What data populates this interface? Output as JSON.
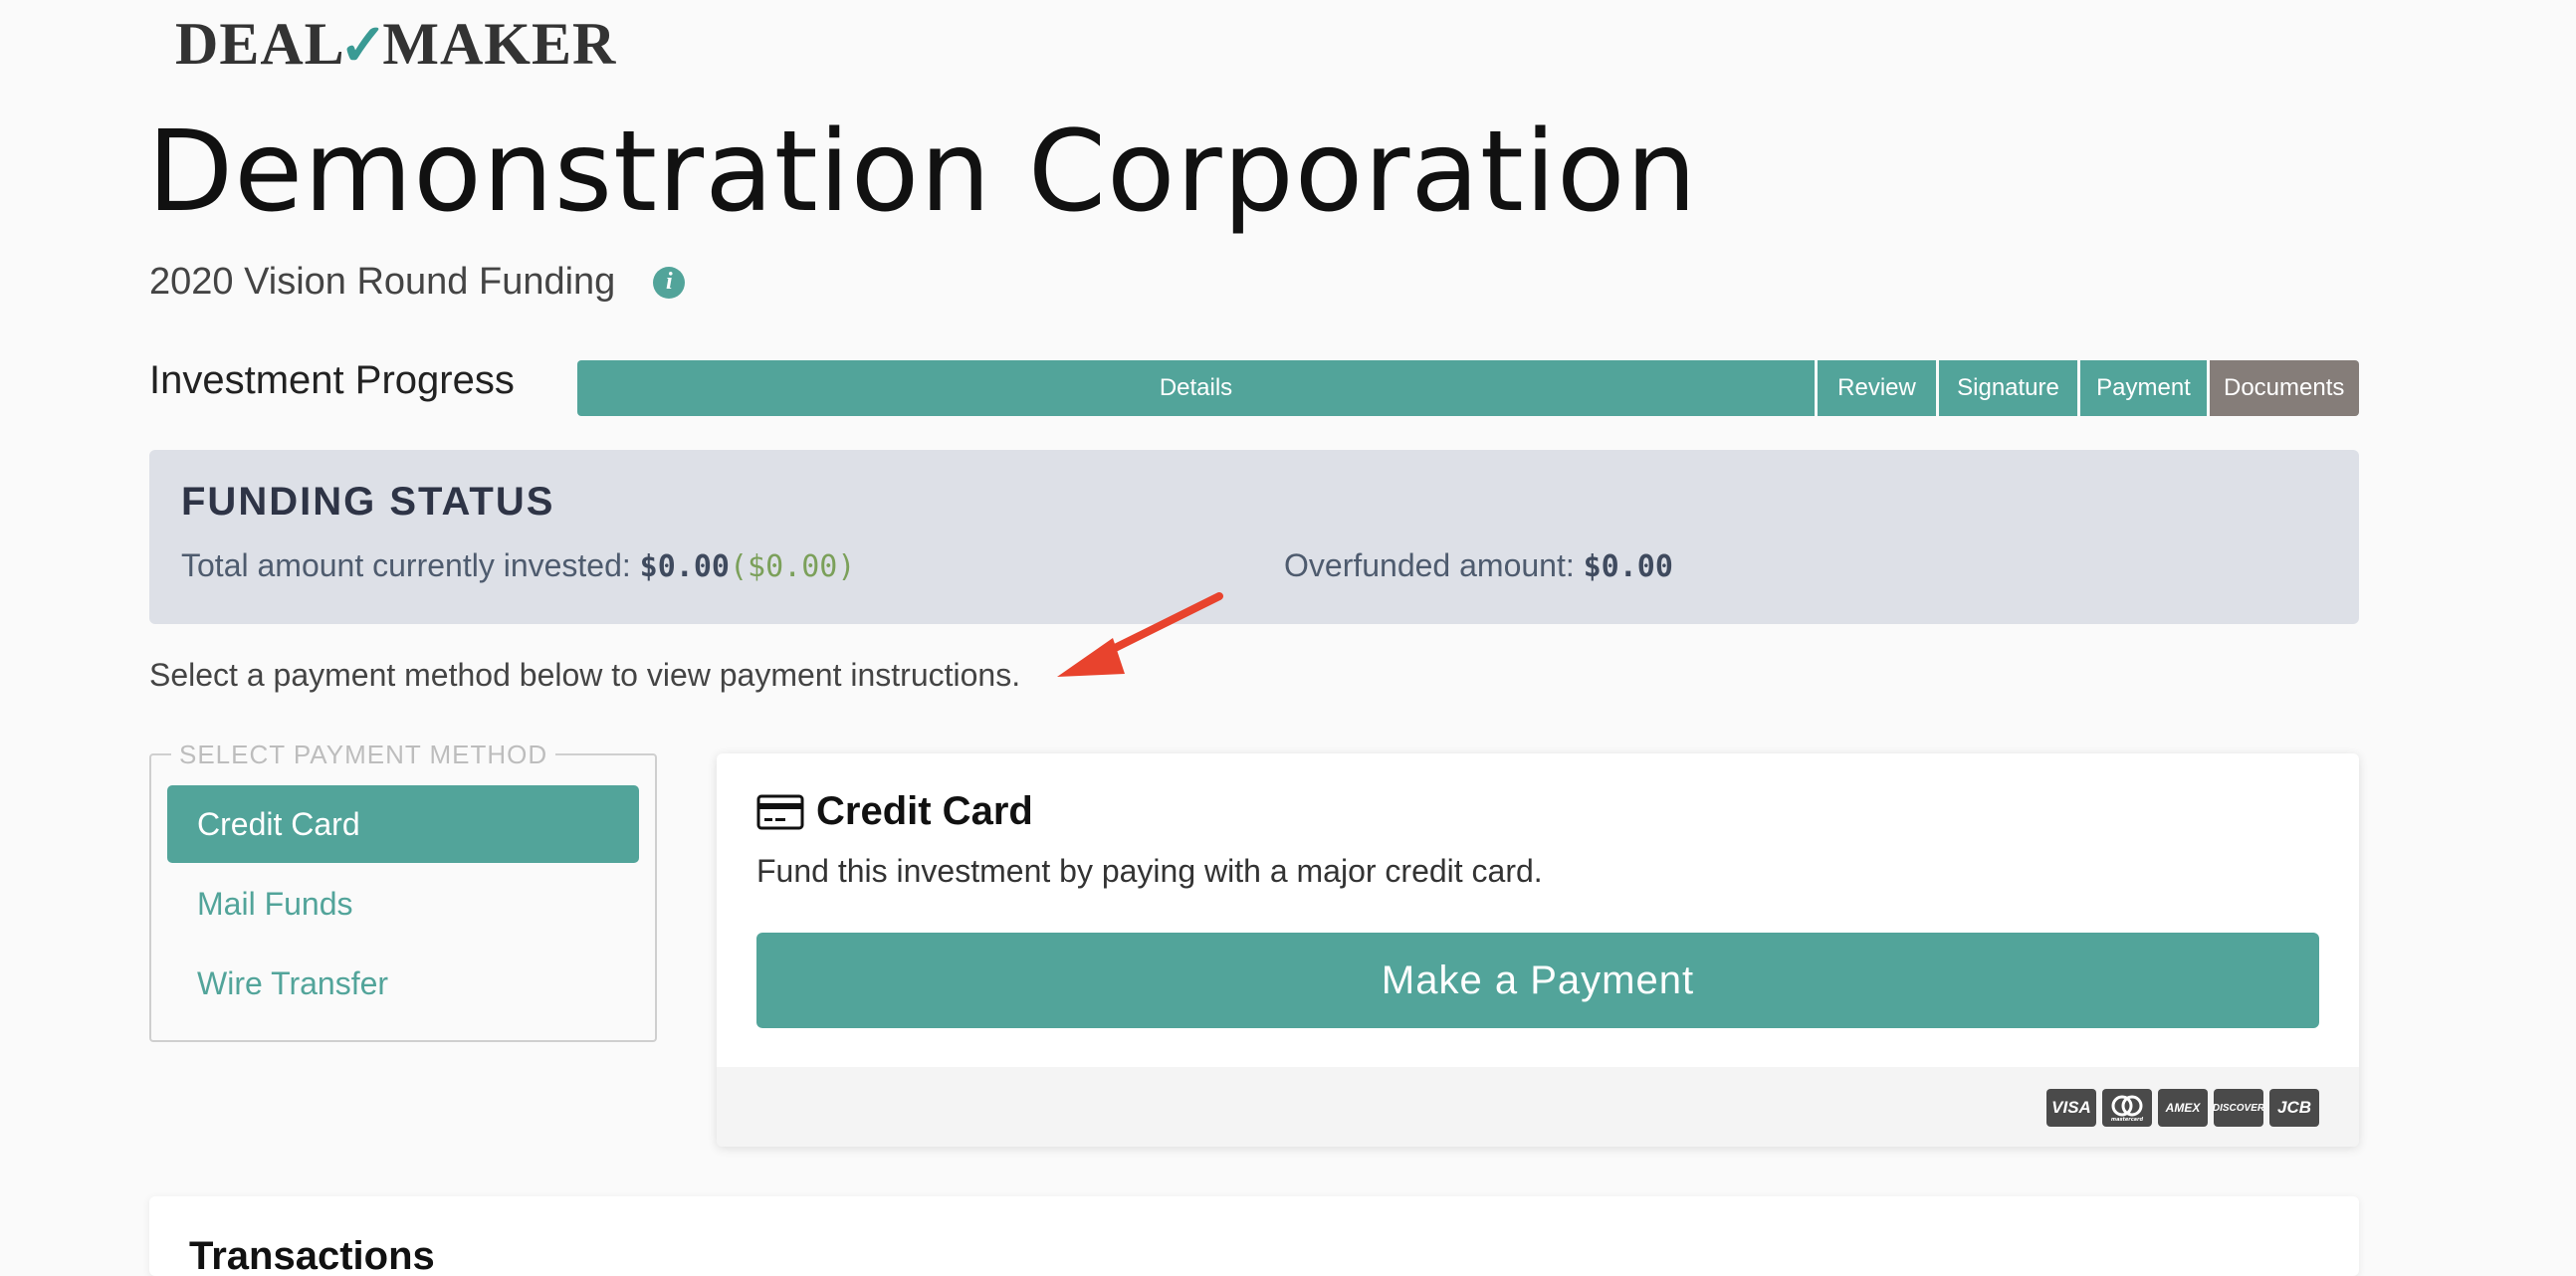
{
  "logo": {
    "left": "DEAL",
    "mark": "✓",
    "right": "MAKER"
  },
  "company_name": "Demonstration Corporation",
  "round_name": "2020 Vision Round Funding",
  "investment_progress": {
    "label": "Investment Progress",
    "steps": [
      "Details",
      "Review",
      "Signature",
      "Payment",
      "Documents"
    ]
  },
  "funding_status": {
    "title": "FUNDING STATUS",
    "invested_label": "Total amount currently invested:",
    "invested_value": "$0.00",
    "invested_pending": "($0.00)",
    "overfunded_label": "Overfunded amount:",
    "overfunded_value": "$0.00"
  },
  "instruction": "Select a payment method below to view payment instructions.",
  "payment_methods": {
    "legend": "SELECT PAYMENT METHOD",
    "items": [
      "Credit Card",
      "Mail Funds",
      "Wire Transfer"
    ],
    "selected": "Credit Card"
  },
  "credit_card_panel": {
    "title": "Credit Card",
    "description": "Fund this investment by paying with a major credit card.",
    "button_label": "Make a Payment",
    "brands": [
      "VISA",
      "mastercard",
      "AMEX",
      "DISCOVER",
      "JCB"
    ]
  },
  "transactions": {
    "title": "Transactions"
  },
  "colors": {
    "accent": "#52a49a",
    "documents_step": "#857d79",
    "funding_bg": "#dde0e7",
    "annotation_arrow": "#e8432d"
  }
}
